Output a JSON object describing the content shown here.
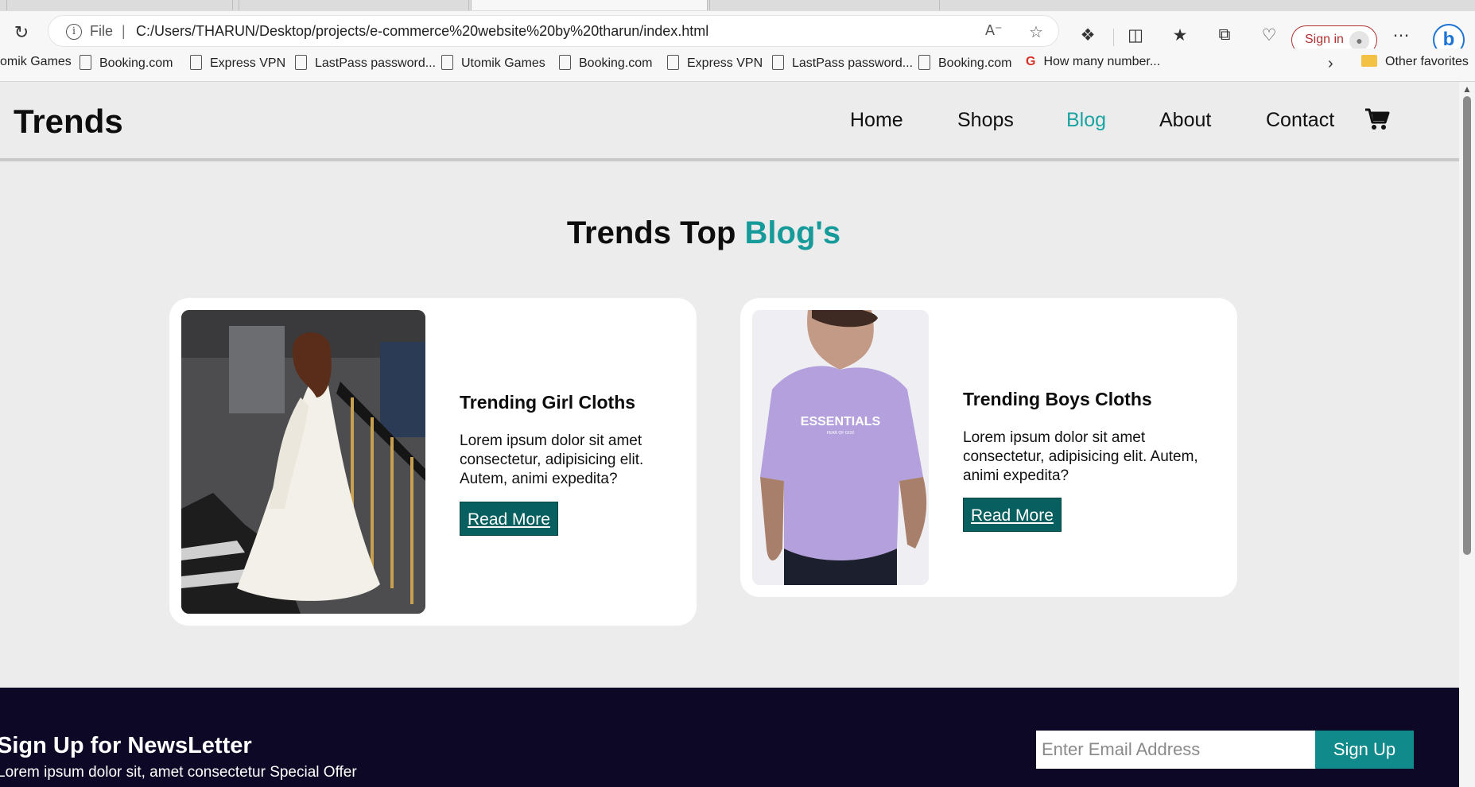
{
  "browser": {
    "address": {
      "scheme_label": "File",
      "url": "C:/Users/THARUN/Desktop/projects/e-commerce%20website%20by%20tharun/index.html"
    },
    "signin_label": "Sign in",
    "bookmarks": [
      "omik Games",
      "Booking.com",
      "Express VPN",
      "LastPass password...",
      "Utomik Games",
      "Booking.com",
      "Express VPN",
      "LastPass password...",
      "Booking.com",
      "How many number..."
    ],
    "other_favorites": "Other favorites"
  },
  "nav": {
    "logo": "Trends",
    "items": [
      "Home",
      "Shops",
      "Blog",
      "About",
      "Contact"
    ],
    "active": "Blog"
  },
  "blog": {
    "title_prefix": "Trends Top",
    "title_accent": "Blog's",
    "cards": [
      {
        "title": "Trending Girl Cloths",
        "text": "Lorem ipsum dolor sit amet consectetur, adipisicing elit. Autem, animi expedita?",
        "button": "Read More"
      },
      {
        "title": "Trending Boys Cloths",
        "text": "Lorem ipsum dolor sit amet consectetur, adipisicing elit. Autem, animi expedita?",
        "button": "Read More",
        "shirt_print": "ESSENTIALS",
        "shirt_sub": "FEAR OF GOD"
      }
    ]
  },
  "newsletter": {
    "title": "Sign Up for NewsLetter",
    "subtitle": "Lorem ipsum dolor sit, amet consectetur Special Offer",
    "email_placeholder": "Enter Email Address",
    "button": "Sign Up"
  },
  "colors": {
    "accent": "#169a9a",
    "button_dark": "#075f5f",
    "footer_bg": "#0d0826"
  }
}
